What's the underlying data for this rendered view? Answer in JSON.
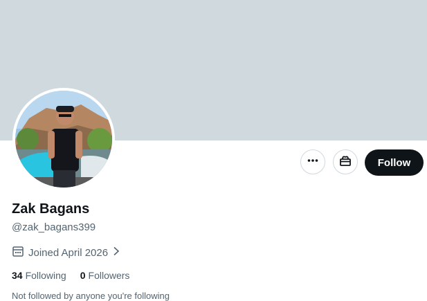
{
  "profile": {
    "display_name": "Zak Bagans",
    "handle": "@zak_bagans399",
    "joined": "Joined April 2026",
    "following_count": "34",
    "following_label": "Following",
    "followers_count": "0",
    "followers_label": "Followers",
    "not_followed_text": "Not followed by anyone you're following"
  },
  "actions": {
    "follow_label": "Follow",
    "more_icon": "more-horizontal-icon",
    "subscribe_icon": "gift-icon"
  },
  "colors": {
    "banner": "#cfd9de",
    "follow_button": "#0f1419",
    "secondary_text": "#536471"
  }
}
